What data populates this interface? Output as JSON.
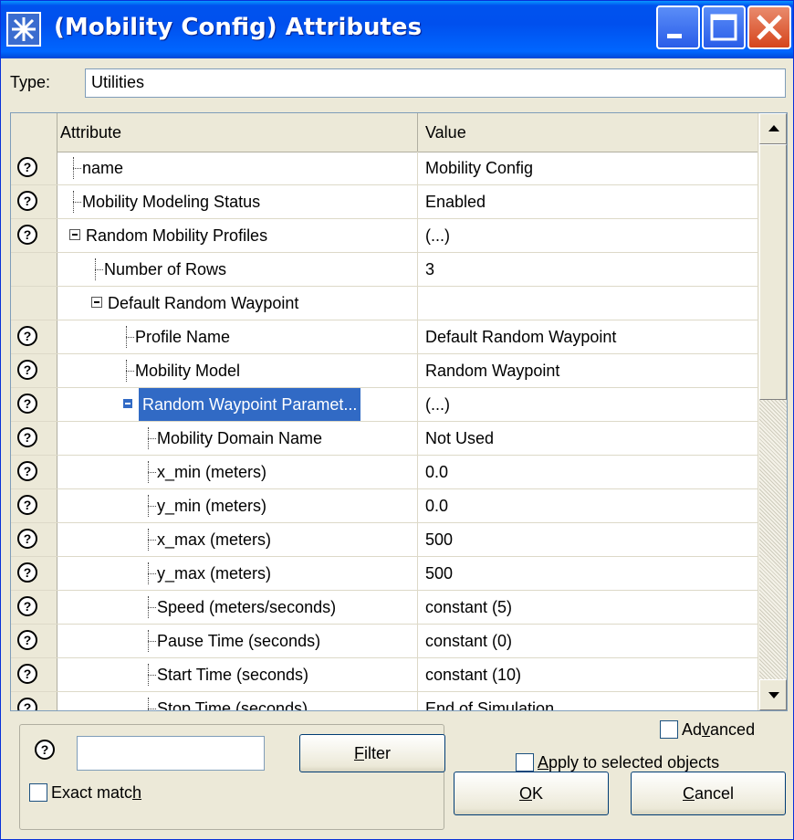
{
  "window": {
    "title": "(Mobility Config) Attributes"
  },
  "type": {
    "label": "Type:",
    "value": "Utilities"
  },
  "grid": {
    "header": {
      "attribute": "Attribute",
      "value": "Value"
    },
    "rows": [
      {
        "attr": "name",
        "value": "Mobility Config",
        "help": true
      },
      {
        "attr": "Mobility Modeling Status",
        "value": "Enabled",
        "help": true
      },
      {
        "attr": "Random Mobility Profiles",
        "value": "(...)",
        "help": true
      },
      {
        "attr": "Number of Rows",
        "value": "3",
        "help": false
      },
      {
        "attr": "Default Random Waypoint",
        "value": "",
        "help": false
      },
      {
        "attr": "Profile Name",
        "value": "Default Random Waypoint",
        "help": true
      },
      {
        "attr": "Mobility Model",
        "value": "Random Waypoint",
        "help": true
      },
      {
        "attr": "Random Waypoint Paramet...",
        "value": "(...)",
        "help": true,
        "selected": true
      },
      {
        "attr": "Mobility Domain Name",
        "value": "Not Used",
        "help": true
      },
      {
        "attr": "x_min (meters)",
        "value": "0.0",
        "help": true
      },
      {
        "attr": "y_min (meters)",
        "value": "0.0",
        "help": true
      },
      {
        "attr": "x_max (meters)",
        "value": "500",
        "help": true
      },
      {
        "attr": "y_max (meters)",
        "value": "500",
        "help": true
      },
      {
        "attr": "Speed (meters/seconds)",
        "value": "constant (5)",
        "help": true
      },
      {
        "attr": "Pause Time (seconds)",
        "value": "constant (0)",
        "help": true
      },
      {
        "attr": "Start Time (seconds)",
        "value": "constant (10)",
        "help": true
      },
      {
        "attr": "Stop Time (seconds)",
        "value": "End of Simulation",
        "help": true
      }
    ]
  },
  "filter": {
    "value": "",
    "button": {
      "pre": "",
      "key": "F",
      "post": "ilter"
    }
  },
  "exact_match": {
    "pre": "Exact matc",
    "key": "h",
    "post": "",
    "checked": false
  },
  "advanced": {
    "pre": "Ad",
    "key": "v",
    "post": "anced",
    "checked": false
  },
  "apply_selected": {
    "pre": "",
    "key": "A",
    "post": "pply to selected objects",
    "checked": false
  },
  "ok": {
    "pre": "",
    "key": "O",
    "post": "K"
  },
  "cancel": {
    "pre": "",
    "key": "C",
    "post": "ancel"
  },
  "help_symbol": "?"
}
